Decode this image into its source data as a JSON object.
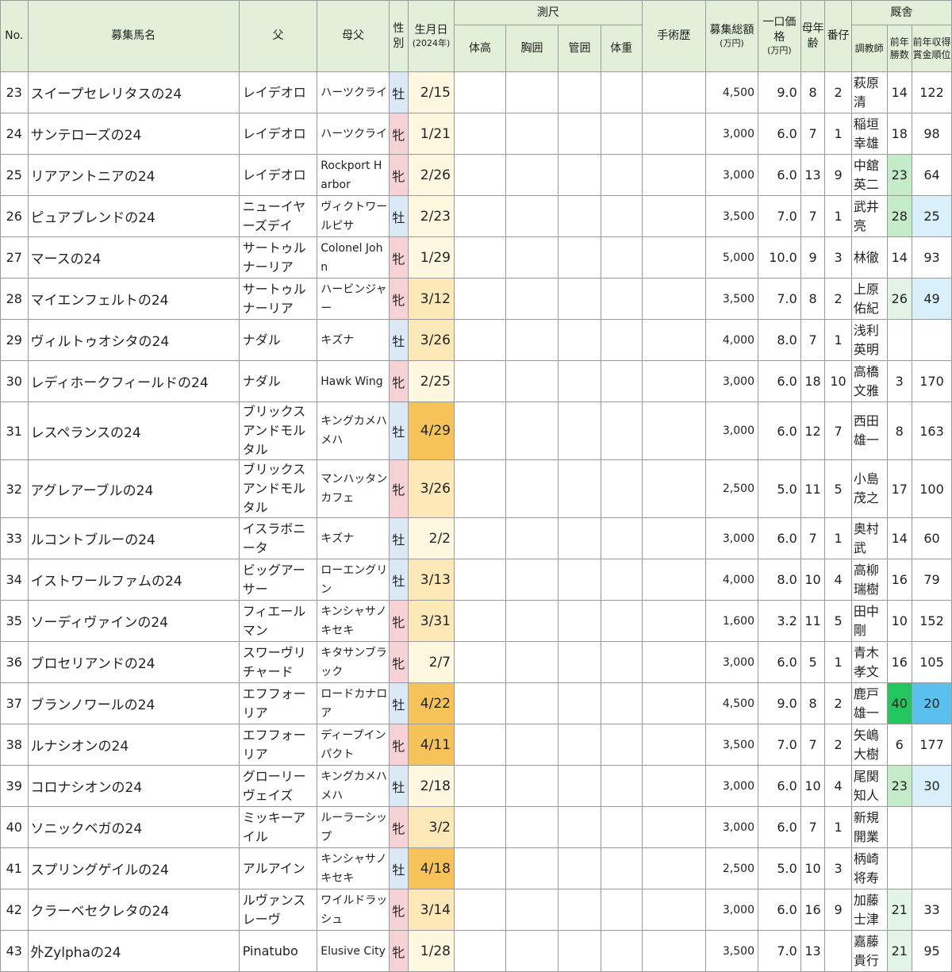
{
  "headers": {
    "no": "No.",
    "name": "募集馬名",
    "sire": "父",
    "damsire": "母父",
    "sex": "性別",
    "birthday": "生月日",
    "birthday_sub": "(2024年)",
    "measure_group": "測尺",
    "height": "体高",
    "chest": "胸囲",
    "cannon": "管囲",
    "weight": "体重",
    "surgery": "手術歴",
    "total": "募集総額",
    "total_sub": "(万円)",
    "price": "一口価格",
    "price_sub": "(万円)",
    "dam_age": "母年齢",
    "order": "番仔",
    "stable_group": "厩舎",
    "trainer": "調教師",
    "wins": "前年勝数",
    "rank": "前年収得賞金順位"
  },
  "colors": {
    "header_bg": "#e2f0d9",
    "male": "#dbe9f7",
    "female": "#f6d1d6",
    "birthday_early": "#fff8e1",
    "birthday_mid": "#fde9b8",
    "birthday_late": "#f5c35a",
    "wins_light": "#e2f5e5",
    "wins_mid": "#c4ecc8",
    "wins_strong": "#22c55e",
    "rank_light": "#d9f0fb",
    "rank_strong": "#5cc0ee"
  },
  "rows": [
    {
      "no": "23",
      "name": "スイープセレリタスの24",
      "sire": "レイデオロ",
      "damsire": "ハーツクライ",
      "sex": "牡",
      "birthday": "2/15",
      "height": "",
      "chest": "",
      "cannon": "",
      "weight": "",
      "surgery": "",
      "total": "4,500",
      "price": "9.0",
      "dam_age": "8",
      "order": "2",
      "trainer": "萩原清",
      "wins": "14",
      "rank": "122",
      "bday_level": "early",
      "wins_level": "",
      "rank_level": ""
    },
    {
      "no": "24",
      "name": "サンテローズの24",
      "sire": "レイデオロ",
      "damsire": "ハーツクライ",
      "sex": "牝",
      "birthday": "1/21",
      "height": "",
      "chest": "",
      "cannon": "",
      "weight": "",
      "surgery": "",
      "total": "3,000",
      "price": "6.0",
      "dam_age": "7",
      "order": "1",
      "trainer": "稲垣幸雄",
      "wins": "18",
      "rank": "98",
      "bday_level": "early",
      "wins_level": "",
      "rank_level": ""
    },
    {
      "no": "25",
      "name": "リアアントニアの24",
      "sire": "レイデオロ",
      "damsire": "Rockport Harbor",
      "sex": "牝",
      "birthday": "2/26",
      "height": "",
      "chest": "",
      "cannon": "",
      "weight": "",
      "surgery": "",
      "total": "3,000",
      "price": "6.0",
      "dam_age": "13",
      "order": "9",
      "trainer": "中舘英二",
      "wins": "23",
      "rank": "64",
      "bday_level": "early",
      "wins_level": "mid",
      "rank_level": ""
    },
    {
      "no": "26",
      "name": "ピュアブレンドの24",
      "sire": "ニューイヤーズデイ",
      "damsire": "ヴィクトワールピサ",
      "sex": "牡",
      "birthday": "2/23",
      "height": "",
      "chest": "",
      "cannon": "",
      "weight": "",
      "surgery": "",
      "total": "3,500",
      "price": "7.0",
      "dam_age": "7",
      "order": "1",
      "trainer": "武井亮",
      "wins": "28",
      "rank": "25",
      "bday_level": "early",
      "wins_level": "mid",
      "rank_level": "light"
    },
    {
      "no": "27",
      "name": "マースの24",
      "sire": "サートゥルナーリア",
      "damsire": "Colonel John",
      "sex": "牝",
      "birthday": "1/29",
      "height": "",
      "chest": "",
      "cannon": "",
      "weight": "",
      "surgery": "",
      "total": "5,000",
      "price": "10.0",
      "dam_age": "9",
      "order": "3",
      "trainer": "林徹",
      "wins": "14",
      "rank": "93",
      "bday_level": "early",
      "wins_level": "",
      "rank_level": ""
    },
    {
      "no": "28",
      "name": "マイエンフェルトの24",
      "sire": "サートゥルナーリア",
      "damsire": "ハービンジャー",
      "sex": "牝",
      "birthday": "3/12",
      "height": "",
      "chest": "",
      "cannon": "",
      "weight": "",
      "surgery": "",
      "total": "3,500",
      "price": "7.0",
      "dam_age": "8",
      "order": "2",
      "trainer": "上原佑紀",
      "wins": "26",
      "rank": "49",
      "bday_level": "mid",
      "wins_level": "light",
      "rank_level": "light"
    },
    {
      "no": "29",
      "name": "ヴィルトゥオシタの24",
      "sire": "ナダル",
      "damsire": "キズナ",
      "sex": "牡",
      "birthday": "3/26",
      "height": "",
      "chest": "",
      "cannon": "",
      "weight": "",
      "surgery": "",
      "total": "4,000",
      "price": "8.0",
      "dam_age": "7",
      "order": "1",
      "trainer": "浅利英明",
      "wins": "",
      "rank": "",
      "bday_level": "mid",
      "wins_level": "",
      "rank_level": ""
    },
    {
      "no": "30",
      "name": "レディホークフィールドの24",
      "sire": "ナダル",
      "damsire": "Hawk Wing",
      "sex": "牝",
      "birthday": "2/25",
      "height": "",
      "chest": "",
      "cannon": "",
      "weight": "",
      "surgery": "",
      "total": "3,000",
      "price": "6.0",
      "dam_age": "18",
      "order": "10",
      "trainer": "高橋文雅",
      "wins": "3",
      "rank": "170",
      "bday_level": "early",
      "wins_level": "",
      "rank_level": ""
    },
    {
      "no": "31",
      "name": "レスペランスの24",
      "sire": "ブリックスアンドモルタル",
      "damsire": "キングカメハメハ",
      "sex": "牡",
      "birthday": "4/29",
      "height": "",
      "chest": "",
      "cannon": "",
      "weight": "",
      "surgery": "",
      "total": "3,000",
      "price": "6.0",
      "dam_age": "12",
      "order": "7",
      "trainer": "西田雄一",
      "wins": "8",
      "rank": "163",
      "bday_level": "late",
      "wins_level": "",
      "rank_level": ""
    },
    {
      "no": "32",
      "name": "アグレアーブルの24",
      "sire": "ブリックスアンドモルタル",
      "damsire": "マンハッタンカフェ",
      "sex": "牝",
      "birthday": "3/26",
      "height": "",
      "chest": "",
      "cannon": "",
      "weight": "",
      "surgery": "",
      "total": "2,500",
      "price": "5.0",
      "dam_age": "11",
      "order": "5",
      "trainer": "小島茂之",
      "wins": "17",
      "rank": "100",
      "bday_level": "mid",
      "wins_level": "",
      "rank_level": ""
    },
    {
      "no": "33",
      "name": "ルコントブルーの24",
      "sire": "イスラボニータ",
      "damsire": "キズナ",
      "sex": "牡",
      "birthday": "2/2",
      "height": "",
      "chest": "",
      "cannon": "",
      "weight": "",
      "surgery": "",
      "total": "3,000",
      "price": "6.0",
      "dam_age": "7",
      "order": "1",
      "trainer": "奥村武",
      "wins": "14",
      "rank": "60",
      "bday_level": "early",
      "wins_level": "",
      "rank_level": ""
    },
    {
      "no": "34",
      "name": "イストワールファムの24",
      "sire": "ビッグアーサー",
      "damsire": "ローエングリン",
      "sex": "牡",
      "birthday": "3/13",
      "height": "",
      "chest": "",
      "cannon": "",
      "weight": "",
      "surgery": "",
      "total": "4,000",
      "price": "8.0",
      "dam_age": "10",
      "order": "4",
      "trainer": "高柳瑞樹",
      "wins": "16",
      "rank": "79",
      "bday_level": "mid",
      "wins_level": "",
      "rank_level": ""
    },
    {
      "no": "35",
      "name": "ソーディヴァインの24",
      "sire": "フィエールマン",
      "damsire": "キンシャサノキセキ",
      "sex": "牝",
      "birthday": "3/31",
      "height": "",
      "chest": "",
      "cannon": "",
      "weight": "",
      "surgery": "",
      "total": "1,600",
      "price": "3.2",
      "dam_age": "11",
      "order": "5",
      "trainer": "田中剛",
      "wins": "10",
      "rank": "152",
      "bday_level": "mid",
      "wins_level": "",
      "rank_level": ""
    },
    {
      "no": "36",
      "name": "ブロセリアンドの24",
      "sire": "スワーヴリチャード",
      "damsire": "キタサンブラック",
      "sex": "牝",
      "birthday": "2/7",
      "height": "",
      "chest": "",
      "cannon": "",
      "weight": "",
      "surgery": "",
      "total": "3,000",
      "price": "6.0",
      "dam_age": "5",
      "order": "1",
      "trainer": "青木孝文",
      "wins": "16",
      "rank": "105",
      "bday_level": "early",
      "wins_level": "",
      "rank_level": ""
    },
    {
      "no": "37",
      "name": "ブランノワールの24",
      "sire": "エフフォーリア",
      "damsire": "ロードカナロア",
      "sex": "牡",
      "birthday": "4/22",
      "height": "",
      "chest": "",
      "cannon": "",
      "weight": "",
      "surgery": "",
      "total": "4,500",
      "price": "9.0",
      "dam_age": "8",
      "order": "2",
      "trainer": "鹿戸雄一",
      "wins": "40",
      "rank": "20",
      "bday_level": "late",
      "wins_level": "strong",
      "rank_level": "strong"
    },
    {
      "no": "38",
      "name": "ルナシオンの24",
      "sire": "エフフォーリア",
      "damsire": "ディープインパクト",
      "sex": "牝",
      "birthday": "4/11",
      "height": "",
      "chest": "",
      "cannon": "",
      "weight": "",
      "surgery": "",
      "total": "3,500",
      "price": "7.0",
      "dam_age": "7",
      "order": "2",
      "trainer": "矢嶋大樹",
      "wins": "6",
      "rank": "177",
      "bday_level": "late",
      "wins_level": "",
      "rank_level": ""
    },
    {
      "no": "39",
      "name": "コロナシオンの24",
      "sire": "グローリーヴェイズ",
      "damsire": "キングカメハメハ",
      "sex": "牡",
      "birthday": "2/18",
      "height": "",
      "chest": "",
      "cannon": "",
      "weight": "",
      "surgery": "",
      "total": "3,000",
      "price": "6.0",
      "dam_age": "10",
      "order": "4",
      "trainer": "尾関知人",
      "wins": "23",
      "rank": "30",
      "bday_level": "early",
      "wins_level": "mid",
      "rank_level": "light"
    },
    {
      "no": "40",
      "name": "ソニックベガの24",
      "sire": "ミッキーアイル",
      "damsire": "ルーラーシップ",
      "sex": "牝",
      "birthday": "3/2",
      "height": "",
      "chest": "",
      "cannon": "",
      "weight": "",
      "surgery": "",
      "total": "3,000",
      "price": "6.0",
      "dam_age": "7",
      "order": "1",
      "trainer": "新規開業",
      "wins": "",
      "rank": "",
      "bday_level": "mid",
      "wins_level": "",
      "rank_level": ""
    },
    {
      "no": "41",
      "name": "スプリングゲイルの24",
      "sire": "アルアイン",
      "damsire": "キンシャサノキセキ",
      "sex": "牡",
      "birthday": "4/18",
      "height": "",
      "chest": "",
      "cannon": "",
      "weight": "",
      "surgery": "",
      "total": "2,500",
      "price": "5.0",
      "dam_age": "10",
      "order": "3",
      "trainer": "柄崎将寿",
      "wins": "",
      "rank": "",
      "bday_level": "late",
      "wins_level": "",
      "rank_level": ""
    },
    {
      "no": "42",
      "name": "クラーベセクレタの24",
      "sire": "ルヴァンスレーヴ",
      "damsire": "ワイルドラッシュ",
      "sex": "牝",
      "birthday": "3/14",
      "height": "",
      "chest": "",
      "cannon": "",
      "weight": "",
      "surgery": "",
      "total": "3,000",
      "price": "6.0",
      "dam_age": "16",
      "order": "9",
      "trainer": "加藤士津",
      "wins": "21",
      "rank": "33",
      "bday_level": "mid",
      "wins_level": "light",
      "rank_level": ""
    },
    {
      "no": "43",
      "name": "外Zylphaの24",
      "sire": "Pinatubo",
      "damsire": "Elusive City",
      "sex": "牝",
      "birthday": "1/28",
      "height": "",
      "chest": "",
      "cannon": "",
      "weight": "",
      "surgery": "",
      "total": "3,500",
      "price": "7.0",
      "dam_age": "13",
      "order": "",
      "trainer": "嘉藤貴行",
      "wins": "21",
      "rank": "95",
      "bday_level": "early",
      "wins_level": "light",
      "rank_level": ""
    }
  ]
}
